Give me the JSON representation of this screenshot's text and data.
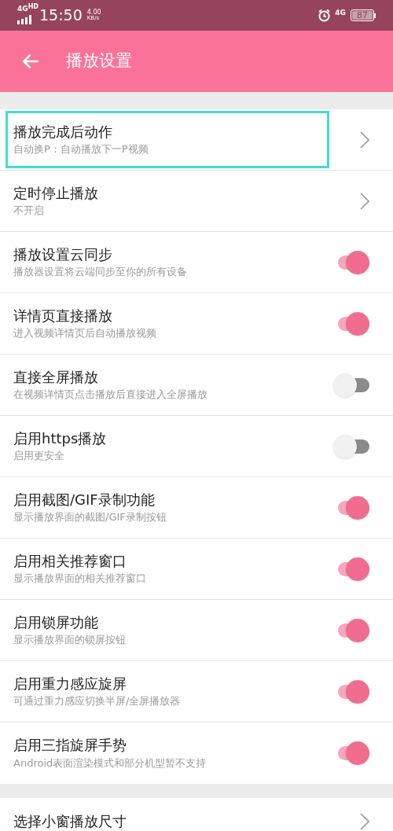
{
  "status_bar": {
    "network": "4G",
    "network_badge": "HD",
    "time": "15:50",
    "speed": "4.00",
    "speed_unit": "KB/s",
    "mobile": "4G",
    "battery": "87"
  },
  "app_bar": {
    "title": "播放设置"
  },
  "settings": [
    {
      "kind": "link",
      "title": "播放完成后动作",
      "subtitle": "自动换P：自动播放下一P视频",
      "highlighted": true
    },
    {
      "kind": "link",
      "title": "定时停止播放",
      "subtitle": "不开启",
      "highlighted": false
    },
    {
      "kind": "toggle",
      "title": "播放设置云同步",
      "subtitle": "播放器设置将云端同步至你的所有设备",
      "on": true,
      "highlighted": false
    },
    {
      "kind": "toggle",
      "title": "详情页直接播放",
      "subtitle": "进入视频详情页后自动播放视频",
      "on": true,
      "highlighted": false
    },
    {
      "kind": "toggle",
      "title": "直接全屏播放",
      "subtitle": "在视频详情页点击播放后直接进入全屏播放",
      "on": false,
      "highlighted": false
    },
    {
      "kind": "toggle",
      "title": "启用https播放",
      "subtitle": "启用更安全",
      "on": false,
      "highlighted": false
    },
    {
      "kind": "toggle",
      "title": "启用截图/GIF录制功能",
      "subtitle": "显示播放界面的截图/GIF录制按钮",
      "on": true,
      "highlighted": false
    },
    {
      "kind": "toggle",
      "title": "启用相关推荐窗口",
      "subtitle": "显示播放界面的相关推荐窗口",
      "on": true,
      "highlighted": false
    },
    {
      "kind": "toggle",
      "title": "启用锁屏功能",
      "subtitle": "显示播放界面的锁屏按钮",
      "on": true,
      "highlighted": false
    },
    {
      "kind": "toggle",
      "title": "启用重力感应旋屏",
      "subtitle": "可通过重力感应切换半屏/全屏播放器",
      "on": true,
      "highlighted": false
    },
    {
      "kind": "toggle",
      "title": "启用三指旋屏手势",
      "subtitle": "Android表面渲染模式和部分机型暂不支持",
      "on": true,
      "highlighted": false
    }
  ],
  "settings_2": [
    {
      "kind": "link",
      "title": "选择小窗播放尺寸"
    }
  ]
}
